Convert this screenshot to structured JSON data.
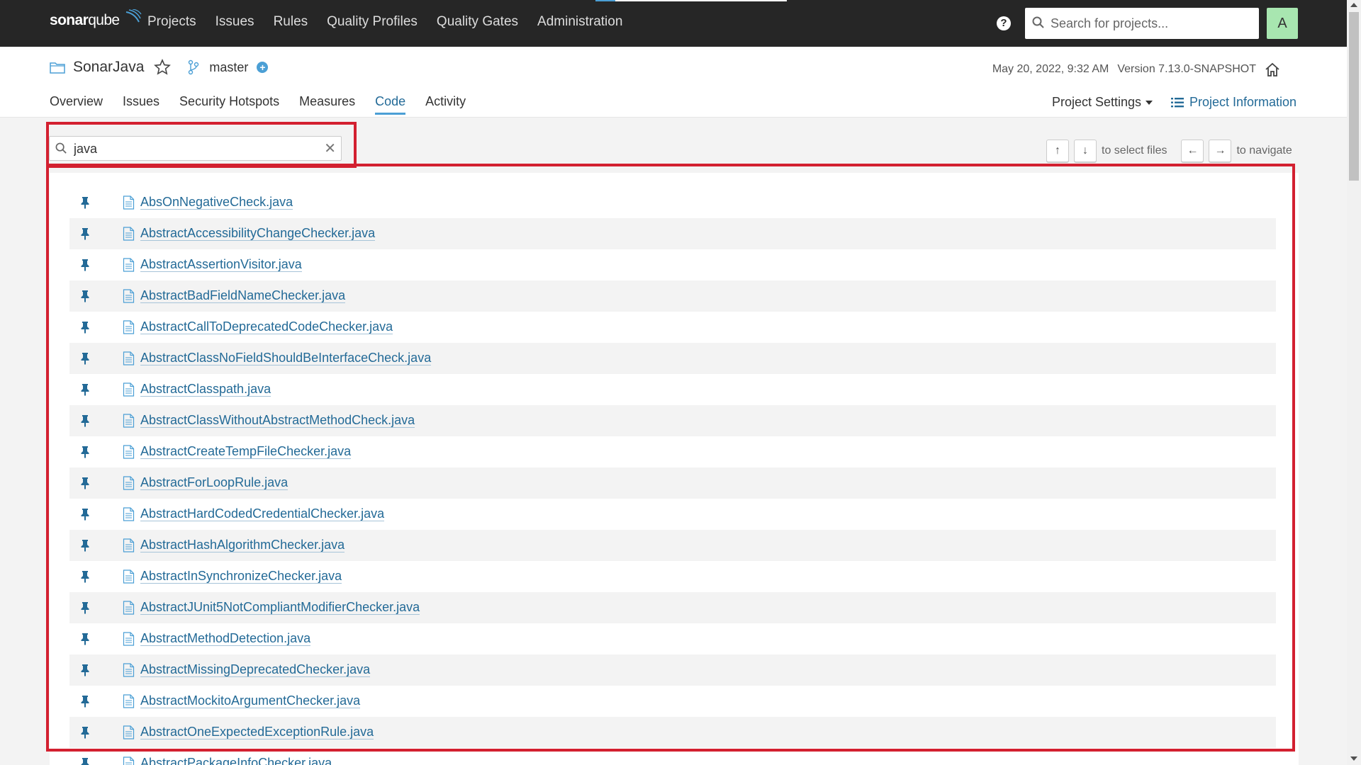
{
  "topnav": {
    "logo_bold": "sonar",
    "logo_light": "qube",
    "links": [
      "Projects",
      "Issues",
      "Rules",
      "Quality Profiles",
      "Quality Gates",
      "Administration"
    ],
    "help_glyph": "?",
    "search_placeholder": "Search for projects...",
    "avatar_letter": "A"
  },
  "project": {
    "name": "SonarJava",
    "branch": "master",
    "date": "May 20, 2022, 9:32 AM",
    "version": "Version 7.13.0-SNAPSHOT",
    "tabs": [
      "Overview",
      "Issues",
      "Security Hotspots",
      "Measures",
      "Code",
      "Activity"
    ],
    "active_tab": "Code",
    "settings_label": "Project Settings",
    "info_label": "Project Information"
  },
  "code": {
    "search_value": "java",
    "clear_glyph": "✕",
    "select_hint": "to select files",
    "navigate_hint": "to navigate",
    "key_up": "↑",
    "key_down": "↓",
    "key_left": "←",
    "key_right": "→",
    "files": [
      "AbsOnNegativeCheck.java",
      "AbstractAccessibilityChangeChecker.java",
      "AbstractAssertionVisitor.java",
      "AbstractBadFieldNameChecker.java",
      "AbstractCallToDeprecatedCodeChecker.java",
      "AbstractClassNoFieldShouldBeInterfaceCheck.java",
      "AbstractClasspath.java",
      "AbstractClassWithoutAbstractMethodCheck.java",
      "AbstractCreateTempFileChecker.java",
      "AbstractForLoopRule.java",
      "AbstractHardCodedCredentialChecker.java",
      "AbstractHashAlgorithmChecker.java",
      "AbstractInSynchronizeChecker.java",
      "AbstractJUnit5NotCompliantModifierChecker.java",
      "AbstractMethodDetection.java",
      "AbstractMissingDeprecatedChecker.java",
      "AbstractMockitoArgumentChecker.java",
      "AbstractOneExpectedExceptionRule.java",
      "AbstractPackageInfoChecker.java"
    ]
  },
  "colors": {
    "nav_bg": "#262626",
    "link_blue": "#236a97",
    "accent_blue": "#4b9fd5",
    "highlight_red": "#d32030",
    "avatar_bg": "#a8e6b0"
  }
}
